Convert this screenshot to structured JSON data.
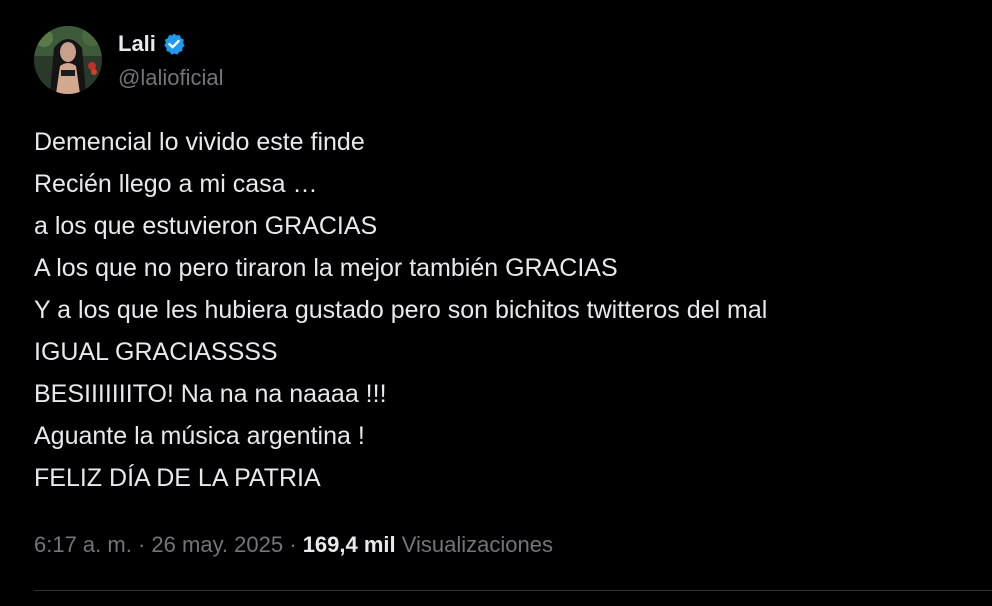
{
  "author": {
    "display_name": "Lali",
    "handle": "@lalioficial",
    "verified": true,
    "verified_color": "#1d9bf0"
  },
  "tweet": {
    "lines": [
      "Demencial lo vivido este finde",
      "Recién llego a mi casa …",
      "a los que estuvieron GRACIAS",
      "A los que no pero tiraron la mejor también GRACIAS",
      "Y a los que les hubiera gustado pero son bichitos twitteros del mal",
      "IGUAL GRACIASSSS",
      "BESIIIIIIITO! Na na na naaaa !!!",
      "Aguante la música argentina !",
      "FELIZ DÍA DE LA PATRIA"
    ]
  },
  "meta": {
    "time": "6:17 a. m.",
    "separator": "·",
    "date": "26 may. 2025",
    "views_count": "169,4 mil",
    "views_label": "Visualizaciones"
  },
  "colors": {
    "background": "#000000",
    "text": "#e7e9ea",
    "muted": "#71767b",
    "divider": "#2f3336"
  }
}
